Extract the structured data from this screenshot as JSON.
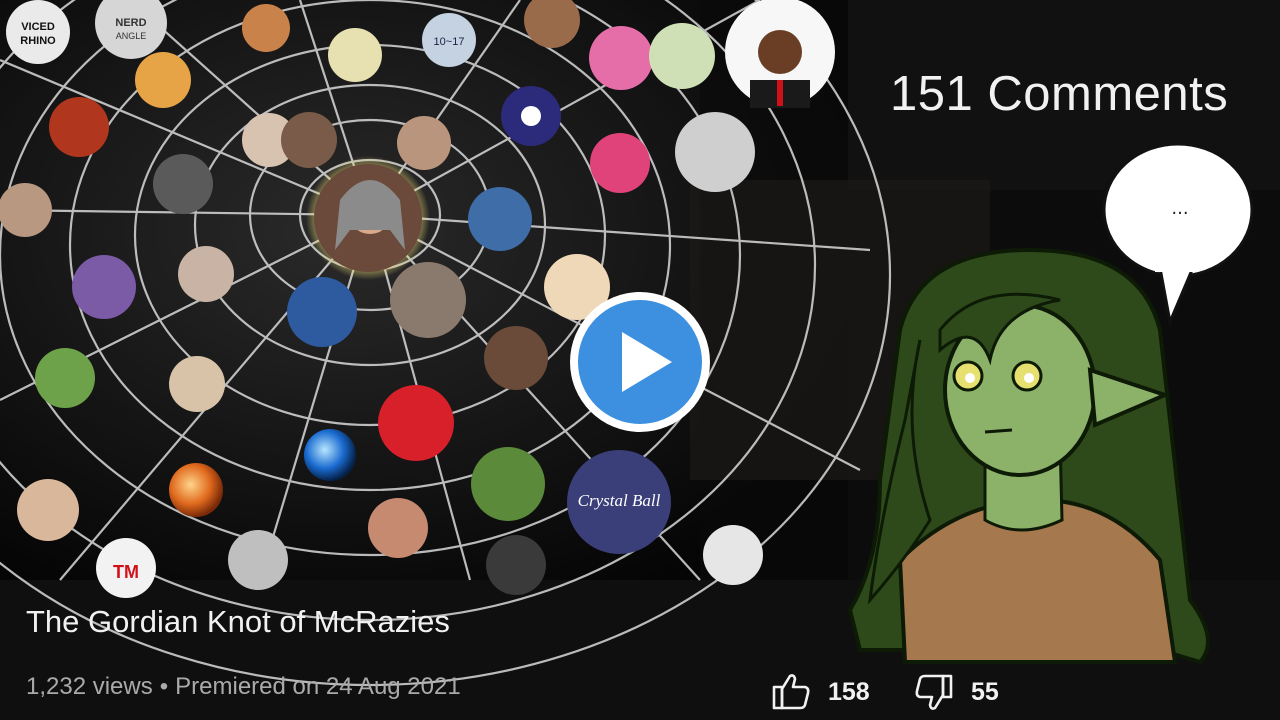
{
  "video": {
    "title": "The Gordian Knot of McRazies",
    "views": "1,232 views",
    "separator": "•",
    "premiered": "Premiered on 24 Aug 2021",
    "likes": "158",
    "dislikes": "55"
  },
  "overlay": {
    "comments_count": "151 Comments",
    "speech_bubble": "..."
  },
  "avatars": [
    {
      "name": "viced-rhino",
      "text": "VICED RHINO",
      "color": "#e9e9e9"
    },
    {
      "name": "nerd-angle",
      "text": "NERD ANGLE",
      "color": "#d7d7d7"
    },
    {
      "name": "avatar-10-17",
      "text": "10~17",
      "color": "#c9d6e6"
    },
    {
      "name": "crystal-ball",
      "text": "Crystal Ball",
      "color": "#3a3f7a"
    },
    {
      "name": "avatar-tm",
      "text": "TM",
      "color": "#f2f2f2"
    }
  ],
  "colors": {
    "background": "#0f0f0f",
    "title_text": "#f1f1f1",
    "meta_text": "#aaaaaa",
    "play_button": "#3d8fe0",
    "character_skin": "#8cb26a",
    "character_hair": "#2e4a1a",
    "character_shirt": "#a5784e"
  }
}
